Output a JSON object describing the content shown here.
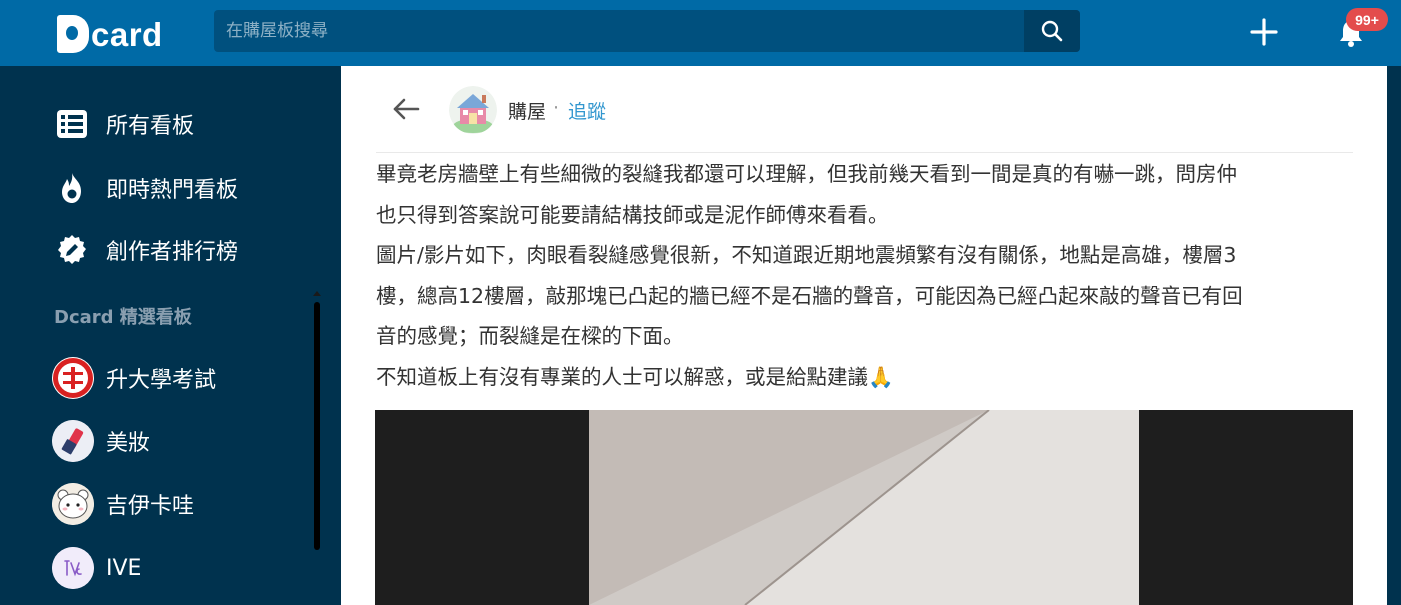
{
  "header": {
    "logo_text": "card",
    "search_placeholder": "在購屋板搜尋",
    "notification_count": "99+"
  },
  "sidebar": {
    "nav": [
      {
        "label": "所有看板",
        "icon": "list-icon"
      },
      {
        "label": "即時熱門看板",
        "icon": "flame-icon"
      },
      {
        "label": "創作者排行榜",
        "icon": "pen-badge-icon"
      }
    ],
    "section_title": "Dcard 精選看板",
    "boards": [
      {
        "label": "升大學考試",
        "icon": "exam-board-avatar"
      },
      {
        "label": "美妝",
        "icon": "makeup-board-avatar"
      },
      {
        "label": "吉伊卡哇",
        "icon": "chiikawa-board-avatar"
      },
      {
        "label": "IVE",
        "icon": "ive-board-avatar"
      }
    ]
  },
  "post": {
    "forum_name": "購屋",
    "separator": "·",
    "follow_label": "追蹤",
    "lines": [
      "畢竟老房牆壁上有些細微的裂縫我都還可以理解，但我前幾天看到一間是真的有嚇一跳，問房仲",
      "也只得到答案說可能要請結構技師或是泥作師傅來看看。",
      "圖片/影片如下，肉眼看裂縫感覺很新，不知道跟近期地震頻繁有沒有關係，地點是高雄，樓層3",
      "樓，總高12樓層，敲那塊已凸起的牆已經不是石牆的聲音，可能因為已經凸起來敲的聲音已有回",
      "音的感覺；而裂縫是在樑的下面。",
      "不知道板上有沒有專業的人士可以解惑，或是給點建議"
    ],
    "emoji": "🙏"
  },
  "colors": {
    "header_bg": "#006aa6",
    "sidebar_bg": "#00324e",
    "link": "#3397cf",
    "badge": "#e34c4c"
  }
}
